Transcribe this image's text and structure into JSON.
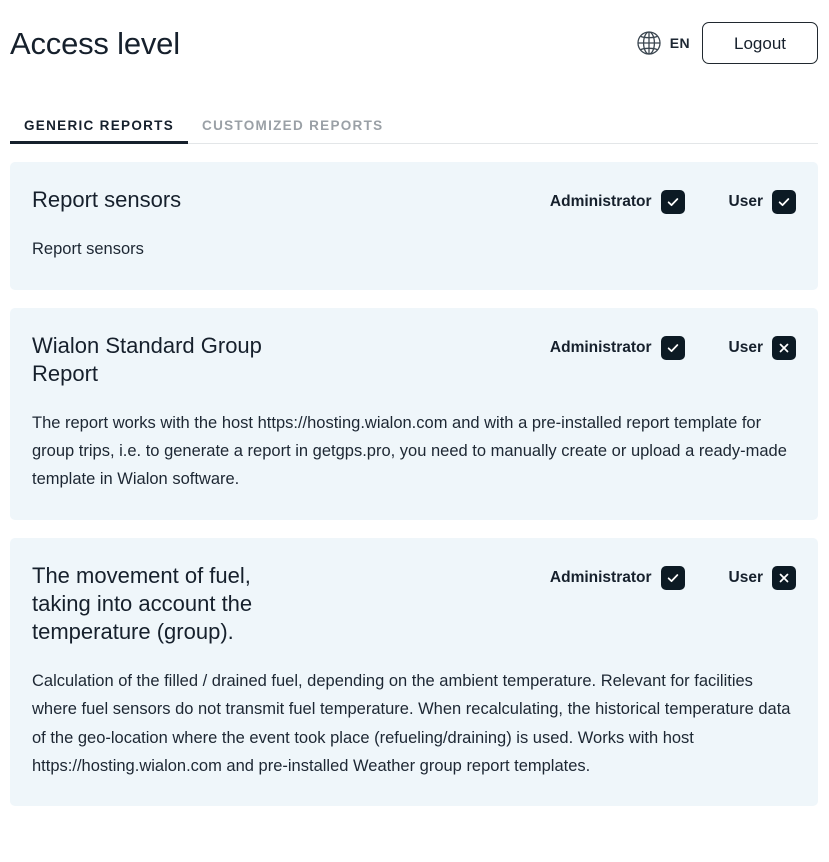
{
  "header": {
    "title": "Access level",
    "language": {
      "icon": "globe-icon",
      "label": "EN"
    },
    "logout_label": "Logout"
  },
  "tabs": [
    {
      "label": "GENERIC REPORTS",
      "active": true
    },
    {
      "label": "CUSTOMIZED REPORTS",
      "active": false
    }
  ],
  "permission_labels": {
    "administrator": "Administrator",
    "user": "User"
  },
  "icons": {
    "checked": "check-icon",
    "unchecked": "close-icon"
  },
  "colors": {
    "card_background": "#eff6fa",
    "checkbox_background": "#0c1a24",
    "text": "#16202c",
    "tab_inactive": "#9aa0a6",
    "page_background": "#ffffff"
  },
  "cards": [
    {
      "title": "Report sensors",
      "description": "Report sensors",
      "administrator": true,
      "user": true
    },
    {
      "title": "Wialon Standard Group Report",
      "description": "The report works with the host https://hosting.wialon.com and with a pre-installed report template for group trips, i.e. to generate a report in getgps.pro, you need to manually create or upload a ready-made template in Wialon software.",
      "administrator": true,
      "user": false
    },
    {
      "title": "The movement of fuel, taking into account the temperature (group).",
      "description": "Calculation of the filled / drained fuel, depending on the ambient temperature. Relevant for facilities where fuel sensors do not transmit fuel temperature. When recalculating, the historical temperature data of the geo-location where the event took place (refueling/draining) is used. Works with host https://hosting.wialon.com and pre-installed Weather group report templates.",
      "administrator": true,
      "user": false
    }
  ]
}
